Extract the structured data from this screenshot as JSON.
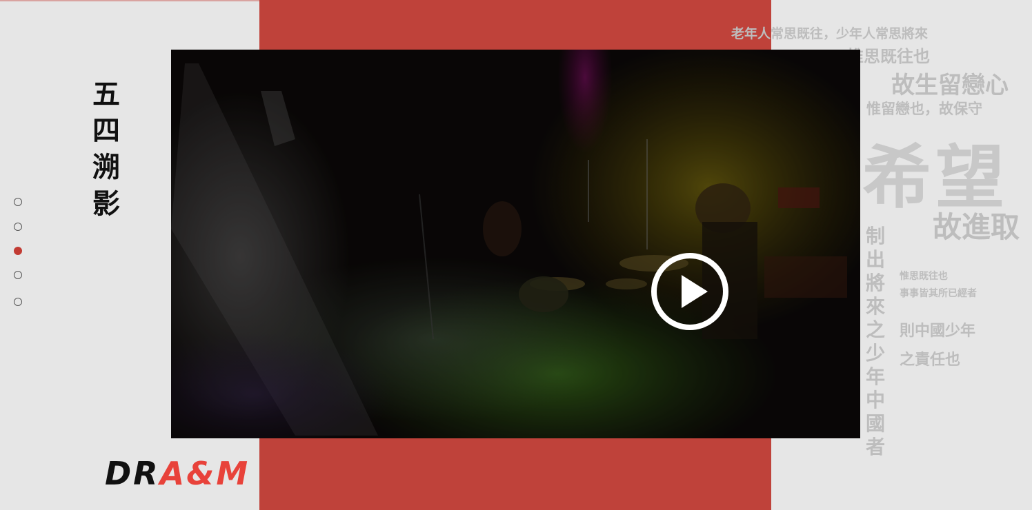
{
  "sidebar": {
    "title_chars": [
      "五",
      "四",
      "溯",
      "影"
    ],
    "nav_dots": [
      {
        "label": "section-1",
        "active": false
      },
      {
        "label": "section-2",
        "active": false
      },
      {
        "label": "section-3",
        "active": true
      },
      {
        "label": "section-4",
        "active": false
      },
      {
        "label": "section-5",
        "active": false
      }
    ]
  },
  "logo": {
    "part1": "DR",
    "part2": "A&M"
  },
  "video": {
    "play_icon": "play-circle-icon"
  },
  "colors": {
    "accent_red": "#bf423a",
    "background": "#e6e6e6",
    "logo_red": "#e8423a"
  },
  "decor_text": {
    "line1": "老年人常思既往，少年人常思將來",
    "line2": "惟思既往也",
    "line3": "故生留戀心",
    "line4": "惟留戀也，故保守",
    "big": "希望",
    "line5": "故進取",
    "vertical": "制出將來之少年中國者",
    "line6": "惟思既往也",
    "line7": "事事皆其所已經者",
    "line8": "則中國少年",
    "line9": "之責任也"
  }
}
